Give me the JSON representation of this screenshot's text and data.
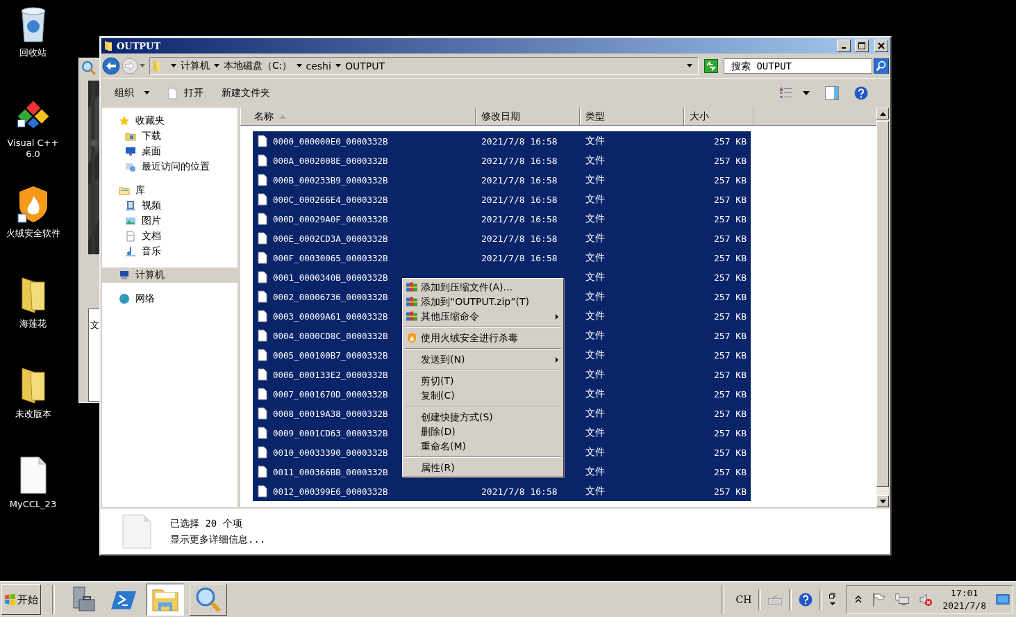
{
  "desktop_icons": [
    {
      "label": "回收站"
    },
    {
      "label": "Visual C++ 6.0"
    },
    {
      "label": "火绒安全软件"
    },
    {
      "label": "海莲花"
    },
    {
      "label": "未改版本"
    },
    {
      "label": "MyCCL_23"
    }
  ],
  "background_window": {
    "text": "文"
  },
  "window": {
    "title": "OUTPUT"
  },
  "address_bar": {
    "crumbs": [
      "计算机",
      "本地磁盘（C:）",
      "ceshi",
      "OUTPUT"
    ]
  },
  "search": {
    "placeholder": "搜索 OUTPUT"
  },
  "toolbar": {
    "buttons": [
      "组织",
      "打开",
      "新建文件夹"
    ]
  },
  "nav": [
    {
      "label": "收藏夹",
      "selected": false,
      "children": [
        {
          "label": "下载",
          "selected": false
        },
        {
          "label": "桌面",
          "selected": false
        },
        {
          "label": "最近访问的位置",
          "selected": false
        }
      ]
    },
    {
      "label": "库",
      "selected": false,
      "children": [
        {
          "label": "视频",
          "selected": false
        },
        {
          "label": "图片",
          "selected": false
        },
        {
          "label": "文档",
          "selected": false
        },
        {
          "label": "音乐",
          "selected": false
        }
      ]
    },
    {
      "label": "计算机",
      "selected": true
    },
    {
      "label": "网络",
      "selected": false
    }
  ],
  "table": {
    "columns": [
      {
        "label": "名称",
        "sorted": true
      },
      {
        "label": "修改日期",
        "sorted": false
      },
      {
        "label": "类型",
        "sorted": false
      },
      {
        "label": "大小",
        "sorted": false
      }
    ],
    "rows": [
      {
        "name": "0000_000000E0_0000332B",
        "modified": "2021/7/8 16:58",
        "type": "文件",
        "size": "257 KB",
        "selected": true
      },
      {
        "name": "000A_0002008E_0000332B",
        "modified": "2021/7/8 16:58",
        "type": "文件",
        "size": "257 KB",
        "selected": true
      },
      {
        "name": "000B_000233B9_0000332B",
        "modified": "2021/7/8 16:58",
        "type": "文件",
        "size": "257 KB",
        "selected": true
      },
      {
        "name": "000C_000266E4_0000332B",
        "modified": "2021/7/8 16:58",
        "type": "文件",
        "size": "257 KB",
        "selected": true
      },
      {
        "name": "000D_00029A0F_0000332B",
        "modified": "2021/7/8 16:58",
        "type": "文件",
        "size": "257 KB",
        "selected": true
      },
      {
        "name": "000E_0002CD3A_0000332B",
        "modified": "2021/7/8 16:58",
        "type": "文件",
        "size": "257 KB",
        "selected": true
      },
      {
        "name": "000F_00030065_0000332B",
        "modified": "2021/7/8 16:58",
        "type": "文件",
        "size": "257 KB",
        "selected": true
      },
      {
        "name": "0001_0000340B_0000332B",
        "type": "文件",
        "size": "257 KB",
        "selected": true
      },
      {
        "name": "0002_00006736_0000332B",
        "type": "文件",
        "size": "257 KB",
        "selected": true
      },
      {
        "name": "0003_00009A61_0000332B",
        "type": "文件",
        "size": "257 KB",
        "selected": true
      },
      {
        "name": "0004_0000CD8C_0000332B",
        "type": "文件",
        "size": "257 KB",
        "selected": true
      },
      {
        "name": "0005_000100B7_0000332B",
        "type": "文件",
        "size": "257 KB",
        "selected": true
      },
      {
        "name": "0006_000133E2_0000332B",
        "type": "文件",
        "size": "257 KB",
        "selected": true
      },
      {
        "name": "0007_0001670D_0000332B",
        "type": "文件",
        "size": "257 KB",
        "selected": true
      },
      {
        "name": "0008_00019A38_0000332B",
        "type": "文件",
        "size": "257 KB",
        "selected": true
      },
      {
        "name": "0009_0001CD63_0000332B",
        "type": "文件",
        "size": "257 KB",
        "selected": true
      },
      {
        "name": "0010_00033390_0000332B",
        "type": "文件",
        "size": "257 KB",
        "selected": true
      },
      {
        "name": "0011_000366BB_0000332B",
        "type": "文件",
        "size": "257 KB",
        "selected": true
      },
      {
        "name": "0012_000399E6_0000332B",
        "modified": "2021/7/8 16:58",
        "type": "文件",
        "size": "257 KB",
        "selected": true
      }
    ]
  },
  "context_menu": {
    "groups": [
      [
        {
          "label": "添加到压缩文件(A)...",
          "kind": "archive",
          "submenu": false
        },
        {
          "label": "添加到“OUTPUT.zip”(T)",
          "kind": "archive",
          "submenu": false
        },
        {
          "label": "其他压缩命令",
          "kind": "archive",
          "submenu": true
        }
      ],
      [
        {
          "label": "使用火绒安全进行杀毒",
          "kind": "shield",
          "submenu": false
        }
      ],
      [
        {
          "label": "发送到(N)",
          "kind": "plain",
          "submenu": true
        }
      ],
      [
        {
          "label": "剪切(T)",
          "kind": "plain",
          "submenu": false
        },
        {
          "label": "复制(C)",
          "kind": "plain",
          "submenu": false
        }
      ],
      [
        {
          "label": "创建快捷方式(S)",
          "kind": "plain",
          "submenu": false
        },
        {
          "label": "删除(D)",
          "kind": "plain",
          "submenu": false
        },
        {
          "label": "重命名(M)",
          "kind": "plain",
          "submenu": false
        }
      ],
      [
        {
          "label": "属性(R)",
          "kind": "plain",
          "submenu": false
        }
      ]
    ]
  },
  "details": {
    "title": "已选择 20 个项",
    "link": "显示更多详细信息..."
  },
  "taskbar": {
    "start": "开始",
    "language": "CH",
    "time": "17:01",
    "date": "2021/7/8"
  }
}
